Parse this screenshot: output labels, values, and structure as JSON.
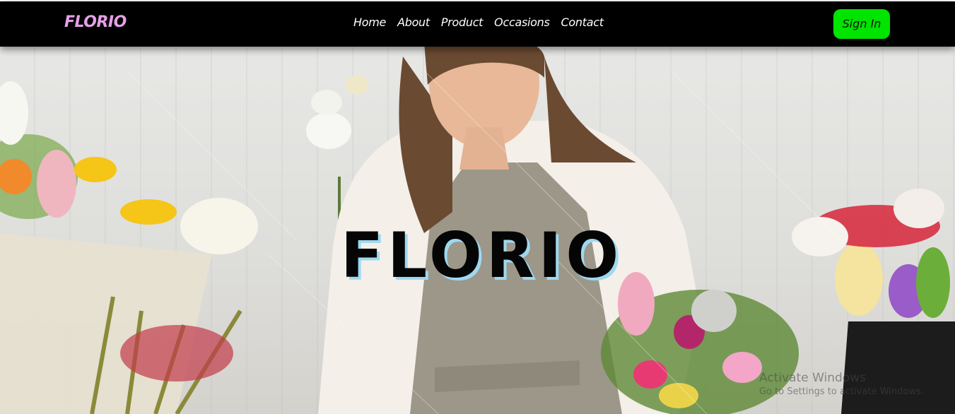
{
  "header": {
    "brand": "FLORIO",
    "nav": [
      {
        "label": "Home"
      },
      {
        "label": "About"
      },
      {
        "label": "Product"
      },
      {
        "label": "Occasions"
      },
      {
        "label": "Contact"
      }
    ],
    "signin_label": "Sign In"
  },
  "hero": {
    "title": "FLORIO"
  },
  "watermark": {
    "line1": "Activate Windows",
    "line2": "Go to Settings to activate Windows."
  },
  "colors": {
    "navbar_bg": "#000000",
    "brand": "#e5a0e6",
    "signin_bg": "#00e400",
    "title_shadow": "#9ed8f0"
  }
}
